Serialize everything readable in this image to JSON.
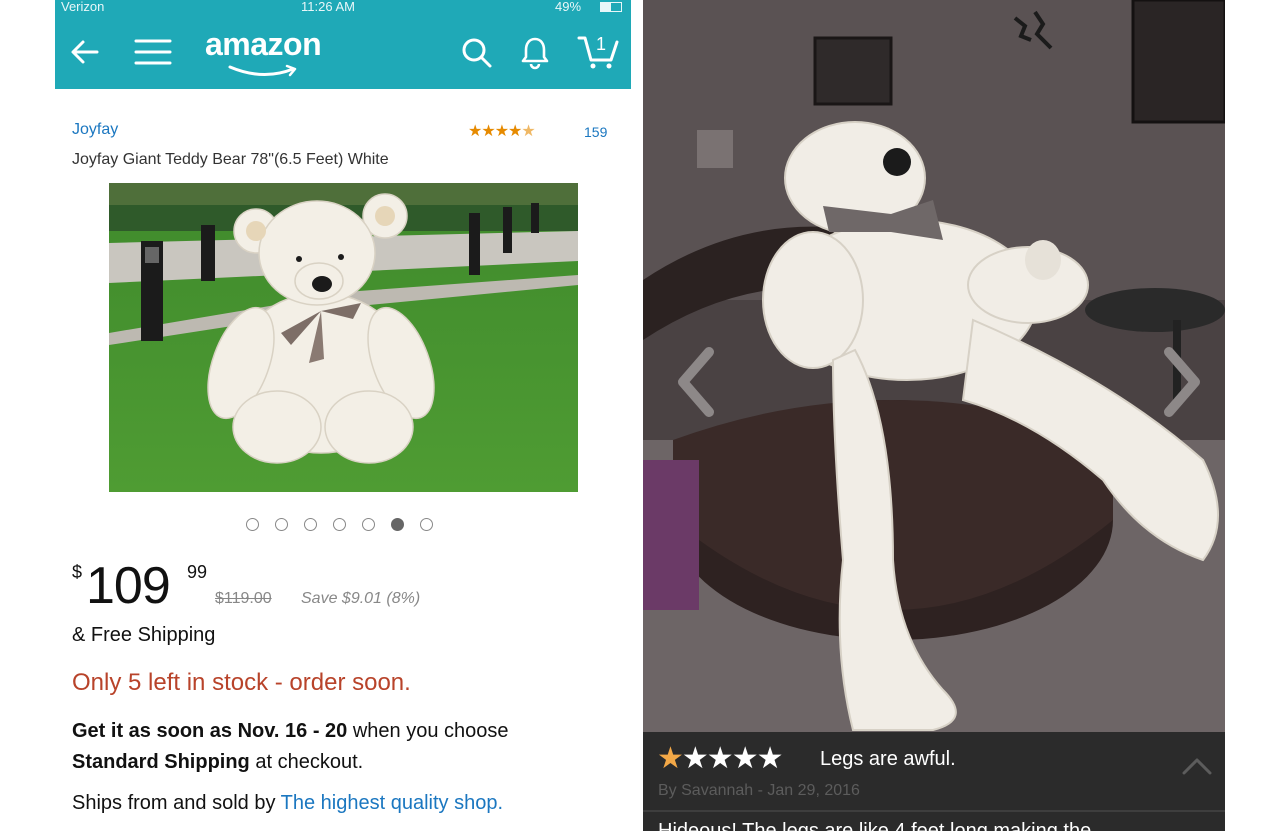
{
  "status_bar": {
    "carrier": "Verizon",
    "time": "11:26 AM",
    "battery": "49%"
  },
  "nav": {
    "logo": "amazon",
    "cart_count": "1",
    "icons": [
      "back-arrow-icon",
      "hamburger-menu-icon",
      "search-icon",
      "bell-icon",
      "cart-icon"
    ],
    "bar_color": "#1fa9b7"
  },
  "product": {
    "brand": "Joyfay",
    "rating": 4.5,
    "review_count": "159",
    "title": "Joyfay Giant Teddy Bear 78\"(6.5 Feet) White",
    "image_index": 6,
    "image_count": 7,
    "price": {
      "currency": "$",
      "whole": "109",
      "fraction": "99",
      "list_price": "$119.00",
      "savings": "Save $9.01 (8%)"
    },
    "shipping": "& Free Shipping",
    "stock": "Only 5 left in stock - order soon.",
    "delivery": {
      "prefix": "Get it as soon as Nov. 16 - 20",
      "middle": " when you choose ",
      "method": "Standard Shipping",
      "suffix": " at checkout."
    },
    "seller": {
      "prefix": "Ships from and sold by ",
      "name": "The highest quality shop."
    },
    "stock_color": "#b8432a",
    "link_color": "#1b77c0"
  },
  "review": {
    "rating": 5,
    "stars_full": "★",
    "stars_rest": "★★★★",
    "title": "Legs are awful.",
    "byline": "By Savannah - Jan 29, 2016",
    "body": "Hideous! The legs are like 4 feet long making the",
    "star_color": "#f3a847"
  }
}
